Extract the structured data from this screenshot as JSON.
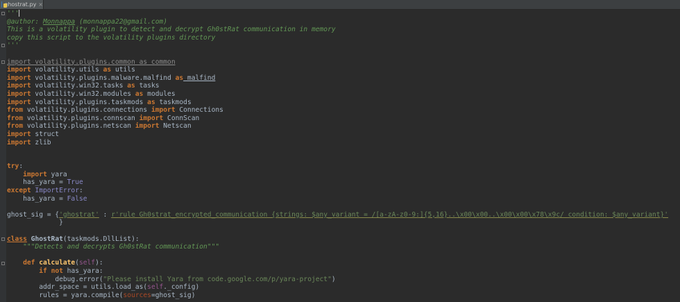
{
  "tab": {
    "file_name": "ghostrat.py",
    "close_glyph": "×"
  },
  "code": {
    "l1_open": "'''",
    "author_prefix": "@author: ",
    "author_name": "Monnappa",
    "author_email": " (monnappa22@gmail.com)",
    "doc_desc": "This is a volatility plugin to detect and decrypt Gh0stRat communication in memory",
    "doc_copy": "copy this script to the volatility plugins directory",
    "doc_close": "'''",
    "imp_common": "import volatility.plugins.common as common",
    "kw_import": "import",
    "kw_from": "from",
    "kw_as": "as",
    "mod_utils": " volatility.utils ",
    "name_utils": " utils",
    "mod_malfind": " volatility.plugins.malware.malfind ",
    "name_malfind": " malfind",
    "mod_tasks": " volatility.win32.tasks ",
    "name_tasks": " tasks",
    "mod_modules": " volatility.win32.modules ",
    "name_modules": " modules",
    "mod_taskmods": " volatility.plugins.taskmods ",
    "name_taskmods": " taskmods",
    "mod_connections": " volatility.plugins.connections ",
    "name_connections": " Connections",
    "mod_connscan": " volatility.plugins.connscan ",
    "name_connscan": " ConnScan",
    "mod_netscan": " volatility.plugins.netscan ",
    "name_netscan": " Netscan",
    "mod_struct": " struct",
    "mod_zlib": " zlib",
    "kw_try": "try",
    "colon": ":",
    "indent4": "    ",
    "indent8": "        ",
    "indent12": "            ",
    "yara_name": " yara",
    "has_yara_eq": "has_yara = ",
    "val_true": "True",
    "val_false": "False",
    "kw_except": "except",
    "import_error": " ImportError",
    "ghost_sig_prefix": "ghost_sig = {",
    "sig_key": "'ghostrat'",
    "sig_sep": " : ",
    "sig_rule": "r'rule Gh0strat_encrypted_communication {strings: $any_variant = /[a-zA-z0-9:]{5,16}..\\x00\\x00..\\x00\\x00\\x78\\x9c/ condition: $any_variant}'",
    "sig_close": "             }",
    "kw_class": "class",
    "class_name": " GhostRat",
    "class_base": "(taskmods.DllList):",
    "class_doc": "\"\"\"Detects and decrypts Gh0stRat communication\"\"\"",
    "kw_def": "def",
    "func_name": " calculate",
    "func_open": "(",
    "kw_self": "self",
    "func_close": "):",
    "kw_if": "if",
    "kw_not": "not",
    "if_cond": " has_yara:",
    "debug_call": "debug.error(",
    "debug_msg": "\"Please install Yara from code.google.com/p/yara-project\"",
    "paren_close": ")",
    "addr_space_prefix": "addr_space = utils.load_as(",
    "config_suffix": "._config)",
    "rules_prefix": "rules = yara.compile(",
    "sources_arg": "sources",
    "sources_suffix": "=ghost_sig)"
  }
}
